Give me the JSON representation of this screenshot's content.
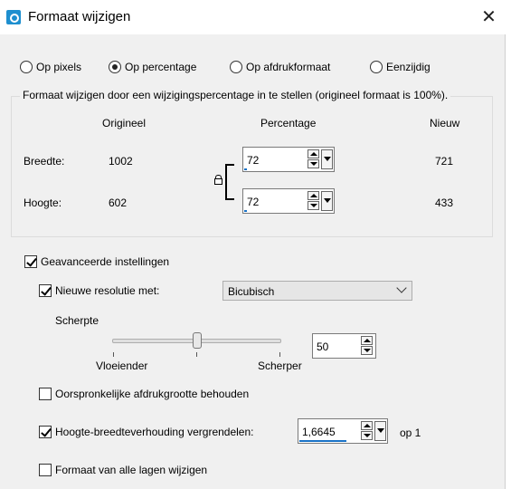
{
  "window": {
    "title": "Formaat wijzigen",
    "close": "✕"
  },
  "mode_options": [
    {
      "label": "Op pixels",
      "selected": false
    },
    {
      "label": "Op percentage",
      "selected": true
    },
    {
      "label": "Op afdrukformaat",
      "selected": false
    },
    {
      "label": "Eenzijdig",
      "selected": false
    }
  ],
  "description": "Formaat wijzigen door een wijzigingspercentage in te stellen (origineel formaat  is 100%).",
  "columns": {
    "original": "Origineel",
    "percentage": "Percentage",
    "new": "Nieuw"
  },
  "rows": {
    "width": {
      "label": "Breedte:",
      "original": "1002",
      "percentage": "72",
      "new": "721"
    },
    "height": {
      "label": "Hoogte:",
      "original": "602",
      "percentage": "72",
      "new": "433"
    }
  },
  "advanced": {
    "label": "Geavanceerde instellingen",
    "checked": true,
    "resolution": {
      "label": "Nieuwe resolutie met:",
      "checked": true,
      "method": "Bicubisch"
    },
    "sharpness": {
      "label": "Scherpte",
      "min_label": "Vloeiender",
      "max_label": "Scherper",
      "value": "50",
      "slider_fraction": 0.5
    },
    "keep_print_size": {
      "label": "Oorspronkelijke afdrukgrootte behouden",
      "checked": false
    },
    "lock_ratio": {
      "label": "Hoogte-breedteverhouding vergrendelen:",
      "checked": true,
      "value": "1,6645",
      "suffix": "op 1"
    },
    "all_layers": {
      "label": "Formaat van alle lagen wijzigen",
      "checked": false
    }
  }
}
